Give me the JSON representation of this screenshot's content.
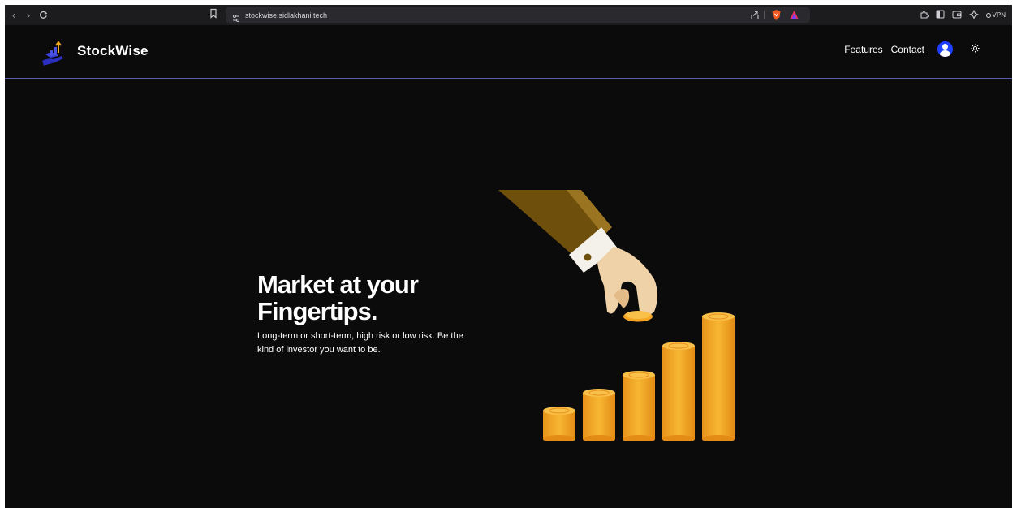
{
  "browser": {
    "url": "stockwise.sidlakhani.tech",
    "vpn_label": "VPN"
  },
  "header": {
    "brand": "StockWise",
    "nav": [
      "Features",
      "Contact"
    ]
  },
  "hero": {
    "title_line1": "Market at your",
    "title_line2": "Fingertips.",
    "subtitle": "Long-term or short-term, high risk or low risk. Be the kind of investor you want to be."
  },
  "colors": {
    "background": "#0b0b0c",
    "accent_blue": "#1f3fff",
    "coin_gold": "#f5a623",
    "sleeve_brown": "#7a5a10"
  },
  "icons": [
    "back-icon",
    "forward-icon",
    "reload-icon",
    "bookmark-icon",
    "share-icon",
    "brave-shield-icon",
    "brave-rewards-icon",
    "extensions-icon",
    "sidebar-icon",
    "wallet-icon",
    "leo-icon",
    "user-icon",
    "sun-icon"
  ]
}
